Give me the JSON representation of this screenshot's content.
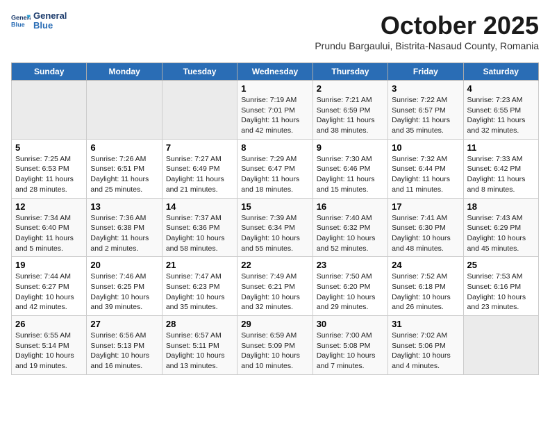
{
  "header": {
    "logo_line1": "General",
    "logo_line2": "Blue",
    "month": "October 2025",
    "location": "Prundu Bargaului, Bistrita-Nasaud County, Romania"
  },
  "weekdays": [
    "Sunday",
    "Monday",
    "Tuesday",
    "Wednesday",
    "Thursday",
    "Friday",
    "Saturday"
  ],
  "weeks": [
    [
      {
        "day": "",
        "content": ""
      },
      {
        "day": "",
        "content": ""
      },
      {
        "day": "",
        "content": ""
      },
      {
        "day": "1",
        "content": "Sunrise: 7:19 AM\nSunset: 7:01 PM\nDaylight: 11 hours and 42 minutes."
      },
      {
        "day": "2",
        "content": "Sunrise: 7:21 AM\nSunset: 6:59 PM\nDaylight: 11 hours and 38 minutes."
      },
      {
        "day": "3",
        "content": "Sunrise: 7:22 AM\nSunset: 6:57 PM\nDaylight: 11 hours and 35 minutes."
      },
      {
        "day": "4",
        "content": "Sunrise: 7:23 AM\nSunset: 6:55 PM\nDaylight: 11 hours and 32 minutes."
      }
    ],
    [
      {
        "day": "5",
        "content": "Sunrise: 7:25 AM\nSunset: 6:53 PM\nDaylight: 11 hours and 28 minutes."
      },
      {
        "day": "6",
        "content": "Sunrise: 7:26 AM\nSunset: 6:51 PM\nDaylight: 11 hours and 25 minutes."
      },
      {
        "day": "7",
        "content": "Sunrise: 7:27 AM\nSunset: 6:49 PM\nDaylight: 11 hours and 21 minutes."
      },
      {
        "day": "8",
        "content": "Sunrise: 7:29 AM\nSunset: 6:47 PM\nDaylight: 11 hours and 18 minutes."
      },
      {
        "day": "9",
        "content": "Sunrise: 7:30 AM\nSunset: 6:46 PM\nDaylight: 11 hours and 15 minutes."
      },
      {
        "day": "10",
        "content": "Sunrise: 7:32 AM\nSunset: 6:44 PM\nDaylight: 11 hours and 11 minutes."
      },
      {
        "day": "11",
        "content": "Sunrise: 7:33 AM\nSunset: 6:42 PM\nDaylight: 11 hours and 8 minutes."
      }
    ],
    [
      {
        "day": "12",
        "content": "Sunrise: 7:34 AM\nSunset: 6:40 PM\nDaylight: 11 hours and 5 minutes."
      },
      {
        "day": "13",
        "content": "Sunrise: 7:36 AM\nSunset: 6:38 PM\nDaylight: 11 hours and 2 minutes."
      },
      {
        "day": "14",
        "content": "Sunrise: 7:37 AM\nSunset: 6:36 PM\nDaylight: 10 hours and 58 minutes."
      },
      {
        "day": "15",
        "content": "Sunrise: 7:39 AM\nSunset: 6:34 PM\nDaylight: 10 hours and 55 minutes."
      },
      {
        "day": "16",
        "content": "Sunrise: 7:40 AM\nSunset: 6:32 PM\nDaylight: 10 hours and 52 minutes."
      },
      {
        "day": "17",
        "content": "Sunrise: 7:41 AM\nSunset: 6:30 PM\nDaylight: 10 hours and 48 minutes."
      },
      {
        "day": "18",
        "content": "Sunrise: 7:43 AM\nSunset: 6:29 PM\nDaylight: 10 hours and 45 minutes."
      }
    ],
    [
      {
        "day": "19",
        "content": "Sunrise: 7:44 AM\nSunset: 6:27 PM\nDaylight: 10 hours and 42 minutes."
      },
      {
        "day": "20",
        "content": "Sunrise: 7:46 AM\nSunset: 6:25 PM\nDaylight: 10 hours and 39 minutes."
      },
      {
        "day": "21",
        "content": "Sunrise: 7:47 AM\nSunset: 6:23 PM\nDaylight: 10 hours and 35 minutes."
      },
      {
        "day": "22",
        "content": "Sunrise: 7:49 AM\nSunset: 6:21 PM\nDaylight: 10 hours and 32 minutes."
      },
      {
        "day": "23",
        "content": "Sunrise: 7:50 AM\nSunset: 6:20 PM\nDaylight: 10 hours and 29 minutes."
      },
      {
        "day": "24",
        "content": "Sunrise: 7:52 AM\nSunset: 6:18 PM\nDaylight: 10 hours and 26 minutes."
      },
      {
        "day": "25",
        "content": "Sunrise: 7:53 AM\nSunset: 6:16 PM\nDaylight: 10 hours and 23 minutes."
      }
    ],
    [
      {
        "day": "26",
        "content": "Sunrise: 6:55 AM\nSunset: 5:14 PM\nDaylight: 10 hours and 19 minutes."
      },
      {
        "day": "27",
        "content": "Sunrise: 6:56 AM\nSunset: 5:13 PM\nDaylight: 10 hours and 16 minutes."
      },
      {
        "day": "28",
        "content": "Sunrise: 6:57 AM\nSunset: 5:11 PM\nDaylight: 10 hours and 13 minutes."
      },
      {
        "day": "29",
        "content": "Sunrise: 6:59 AM\nSunset: 5:09 PM\nDaylight: 10 hours and 10 minutes."
      },
      {
        "day": "30",
        "content": "Sunrise: 7:00 AM\nSunset: 5:08 PM\nDaylight: 10 hours and 7 minutes."
      },
      {
        "day": "31",
        "content": "Sunrise: 7:02 AM\nSunset: 5:06 PM\nDaylight: 10 hours and 4 minutes."
      },
      {
        "day": "",
        "content": ""
      }
    ]
  ]
}
